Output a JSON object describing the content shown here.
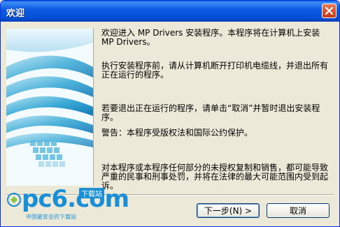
{
  "window": {
    "title": "欢迎"
  },
  "body": {
    "p1": "欢迎进入 MP Drivers 安装程序。本程序将在计算机上安装 MP Drivers。",
    "p2": "执行安装程序前，请从计算机断开打印机电缆线，并退出所有正在运行的程序。",
    "p3": "若要退出正在运行的程序，请单击“取消”并暂时退出安装程序。",
    "p4": "警告：本程序受版权法和国际公约保护。",
    "p5": "对本程序或本程序任何部分的未授权复制和销售，都可能导致严重的民事和刑事处罚，并将在法律的最大可能范围内受到起诉。"
  },
  "buttons": {
    "next": "下一步(N) >",
    "cancel": "取消"
  },
  "watermark": {
    "logo": "pc6.com",
    "badge": "下载站",
    "tagline": "中国最安全的下载站"
  },
  "colors": {
    "titlebar": "#0a5de9",
    "dialog_bg": "#ece9d8",
    "accent": "#1a8fd6"
  }
}
